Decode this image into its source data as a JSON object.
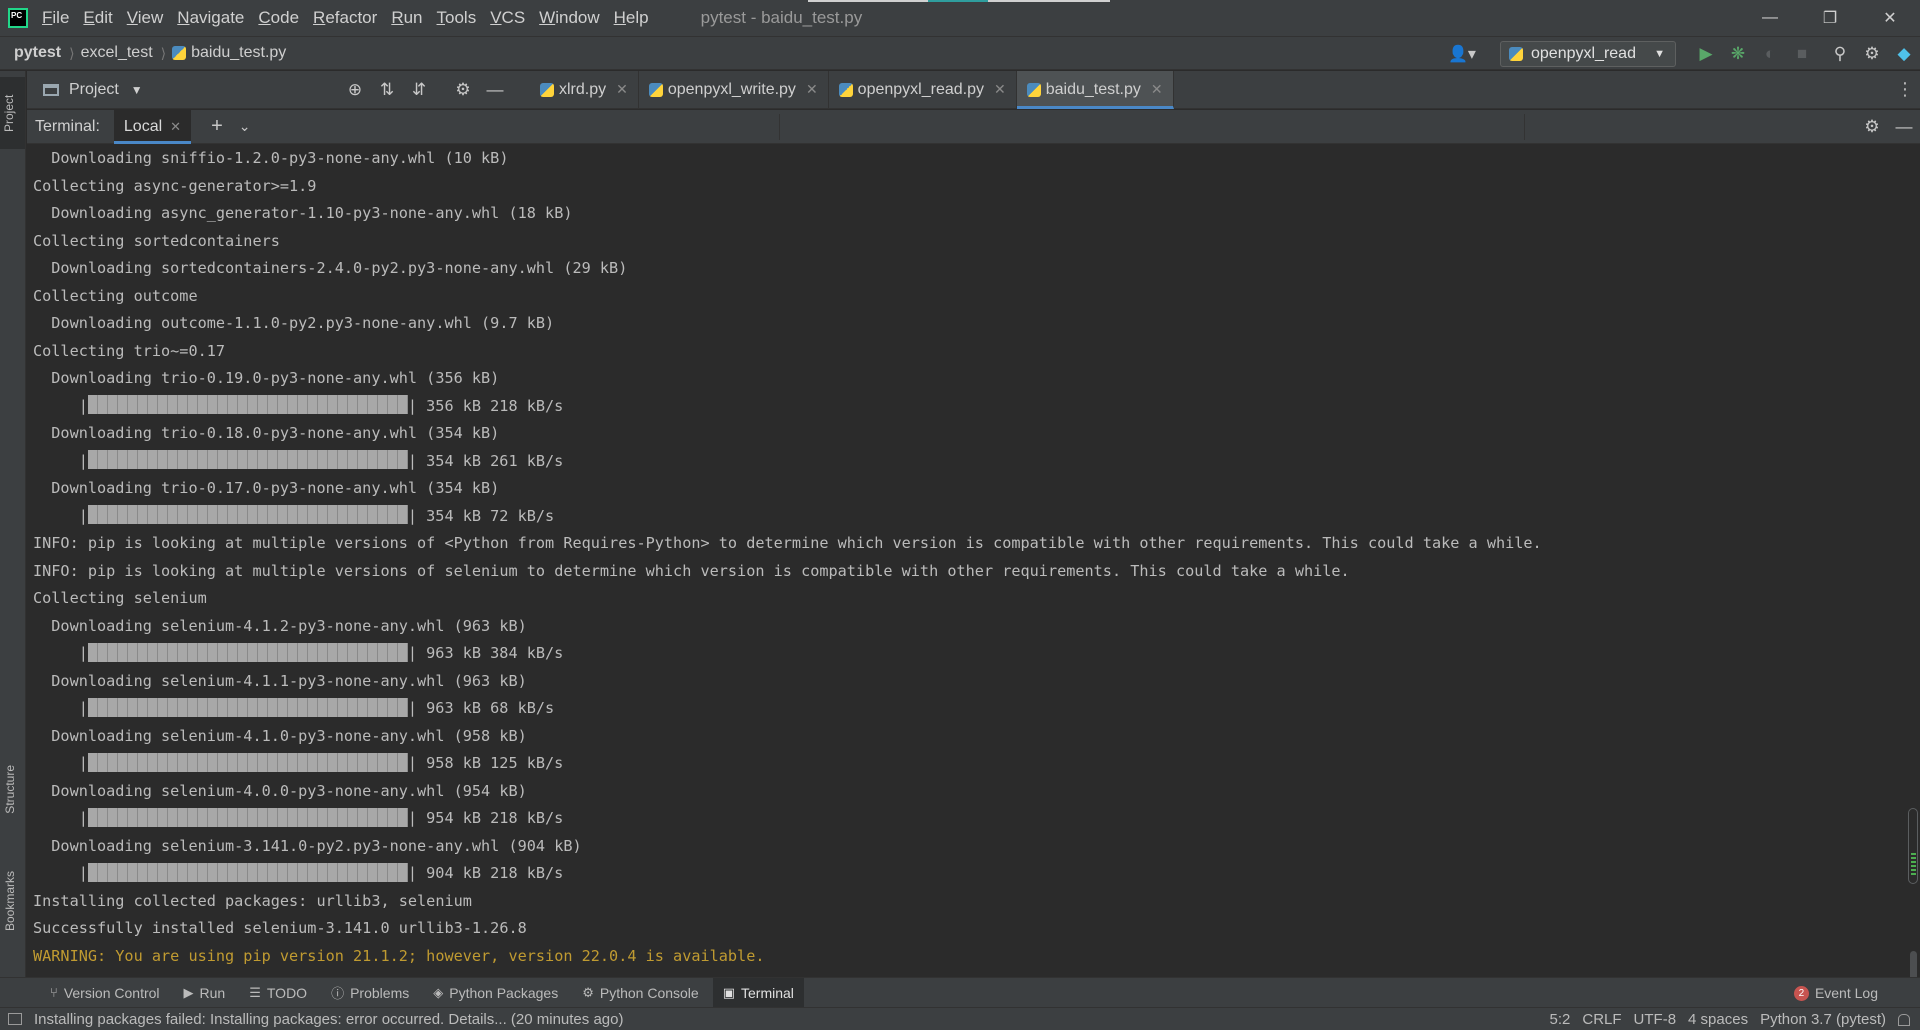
{
  "menu": {
    "items": [
      "File",
      "Edit",
      "View",
      "Navigate",
      "Code",
      "Refactor",
      "Run",
      "Tools",
      "VCS",
      "Window",
      "Help"
    ],
    "window_title": "pytest - baidu_test.py"
  },
  "breadcrumb": {
    "project": "pytest",
    "folder": "excel_test",
    "file": "baidu_test.py"
  },
  "run_config": {
    "name": "openpyxl_read"
  },
  "project_panel": {
    "title": "Project"
  },
  "editor_tabs": [
    {
      "label": "xlrd.py",
      "active": false
    },
    {
      "label": "openpyxl_write.py",
      "active": false
    },
    {
      "label": "openpyxl_read.py",
      "active": false
    },
    {
      "label": "baidu_test.py",
      "active": true
    }
  ],
  "terminal": {
    "label": "Terminal:",
    "tab": "Local",
    "lines": [
      {
        "text": "  Downloading sniffio-1.2.0-py3-none-any.whl (10 kB)"
      },
      {
        "text": "Collecting async-generator>=1.9"
      },
      {
        "text": "  Downloading async_generator-1.10-py3-none-any.whl (18 kB)"
      },
      {
        "text": "Collecting sortedcontainers"
      },
      {
        "text": "  Downloading sortedcontainers-2.4.0-py2.py3-none-any.whl (29 kB)"
      },
      {
        "text": "Collecting outcome"
      },
      {
        "text": "  Downloading outcome-1.1.0-py2.py3-none-any.whl (9.7 kB)"
      },
      {
        "text": "Collecting trio~=0.17"
      },
      {
        "text": "  Downloading trio-0.19.0-py3-none-any.whl (356 kB)"
      },
      {
        "progress": "| 356 kB 218 kB/s"
      },
      {
        "text": "  Downloading trio-0.18.0-py3-none-any.whl (354 kB)"
      },
      {
        "progress": "| 354 kB 261 kB/s"
      },
      {
        "text": "  Downloading trio-0.17.0-py3-none-any.whl (354 kB)"
      },
      {
        "progress": "| 354 kB 72 kB/s"
      },
      {
        "text": "INFO: pip is looking at multiple versions of <Python from Requires-Python> to determine which version is compatible with other requirements. This could take a while."
      },
      {
        "text": "INFO: pip is looking at multiple versions of selenium to determine which version is compatible with other requirements. This could take a while."
      },
      {
        "text": "Collecting selenium"
      },
      {
        "text": "  Downloading selenium-4.1.2-py3-none-any.whl (963 kB)"
      },
      {
        "progress": "| 963 kB 384 kB/s"
      },
      {
        "text": "  Downloading selenium-4.1.1-py3-none-any.whl (963 kB)"
      },
      {
        "progress": "| 963 kB 68 kB/s"
      },
      {
        "text": "  Downloading selenium-4.1.0-py3-none-any.whl (958 kB)"
      },
      {
        "progress": "| 958 kB 125 kB/s"
      },
      {
        "text": "  Downloading selenium-4.0.0-py3-none-any.whl (954 kB)"
      },
      {
        "progress": "| 954 kB 218 kB/s"
      },
      {
        "text": "  Downloading selenium-3.141.0-py2.py3-none-any.whl (904 kB)"
      },
      {
        "progress": "| 904 kB 218 kB/s"
      },
      {
        "text": "Installing collected packages: urllib3, selenium"
      },
      {
        "text": "Successfully installed selenium-3.141.0 urllib3-1.26.8"
      },
      {
        "text": "WARNING: You are using pip version 21.1.2; however, version 22.0.4 is available.",
        "warning": true
      }
    ]
  },
  "tool_windows": [
    {
      "label": "Version Control",
      "icon": "branch-icon"
    },
    {
      "label": "Run",
      "icon": "play-icon"
    },
    {
      "label": "TODO",
      "icon": "list-icon"
    },
    {
      "label": "Problems",
      "icon": "info-icon"
    },
    {
      "label": "Python Packages",
      "icon": "layers-icon"
    },
    {
      "label": "Python Console",
      "icon": "python-icon"
    },
    {
      "label": "Terminal",
      "icon": "terminal-icon",
      "active": true
    }
  ],
  "event_log": {
    "label": "Event Log",
    "count": "2"
  },
  "stripes": {
    "project": "Project",
    "structure": "Structure",
    "bookmarks": "Bookmarks"
  },
  "status": {
    "message": "Installing packages failed: Installing packages: error occurred. Details... (20 minutes ago)",
    "position": "5:2",
    "line_sep": "CRLF",
    "encoding": "UTF-8",
    "indent": "4 spaces",
    "interpreter": "Python 3.7 (pytest)"
  },
  "colors": {
    "accent": "#4a88c7",
    "warning": "#c09b31",
    "run_green": "#59a869",
    "badge_red": "#c75450"
  }
}
